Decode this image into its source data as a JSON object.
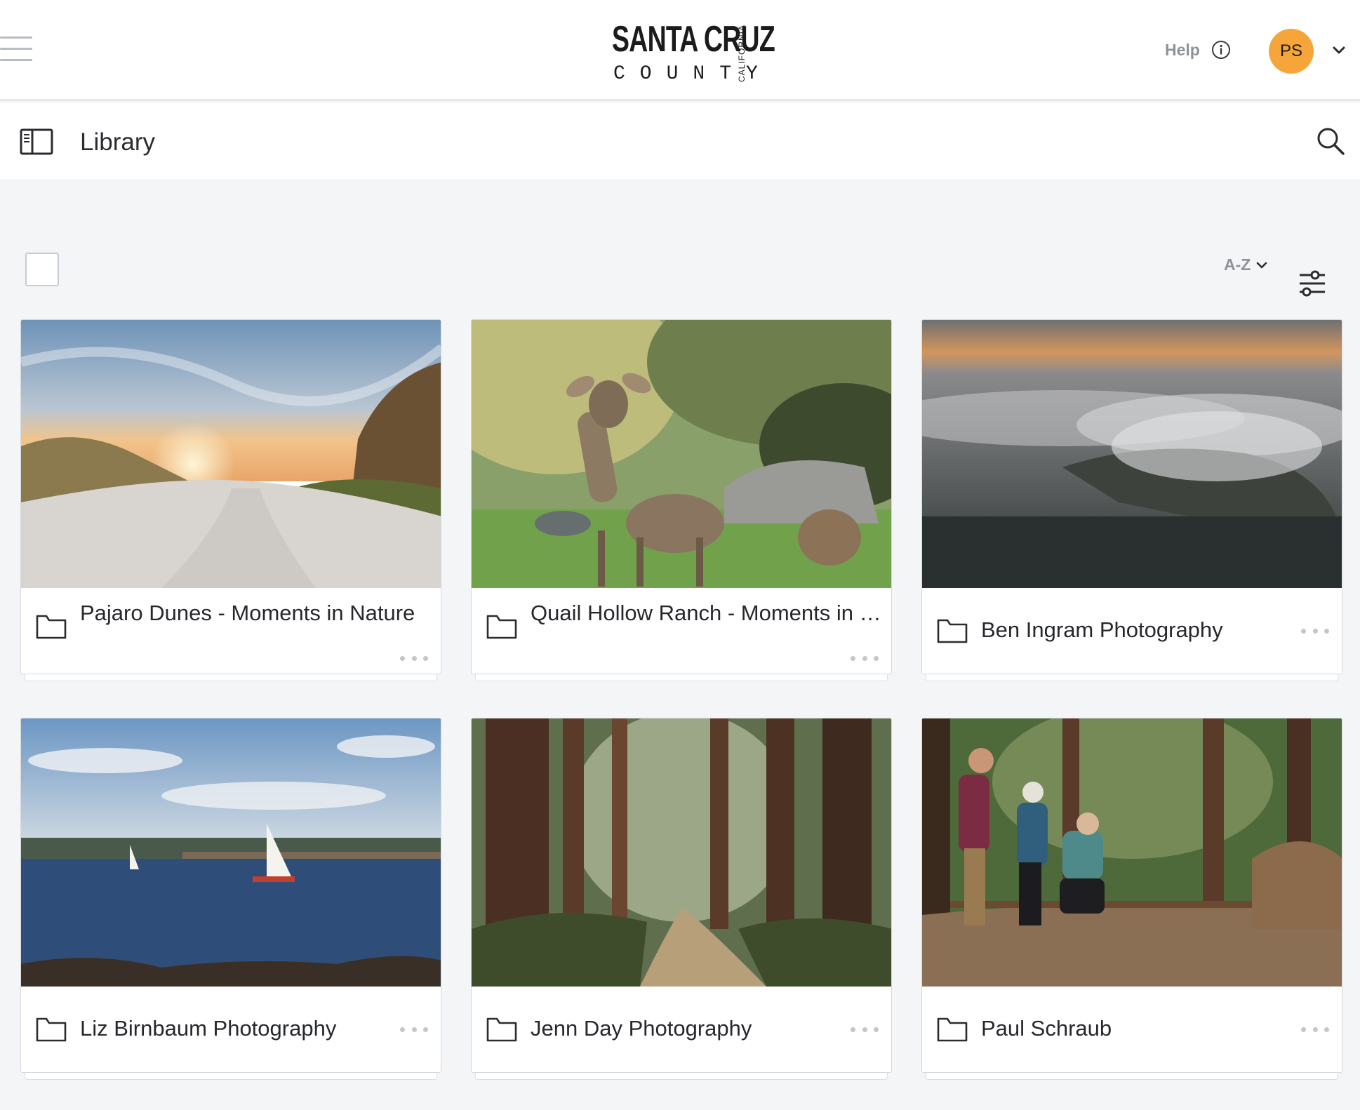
{
  "header": {
    "logo": {
      "line1": "SANTA CRUZ",
      "line2": "COUNTY",
      "state": "CALIFORNIA"
    },
    "help_label": "Help",
    "avatar_initials": "PS"
  },
  "library": {
    "title": "Library"
  },
  "controls": {
    "sort_label": "A-Z"
  },
  "cards": [
    {
      "title": "Pajaro Dunes - Moments in Nature",
      "scene": "dunes-sunset"
    },
    {
      "title": "Quail Hollow Ranch - Moments in Nature",
      "scene": "deer-meadow"
    },
    {
      "title": "Ben Ingram Photography",
      "scene": "fog-coastline"
    },
    {
      "title": "Liz Birnbaum Photography",
      "scene": "harbor-sailboat"
    },
    {
      "title": "Jenn Day Photography",
      "scene": "redwood-trail"
    },
    {
      "title": "Paul Schraub",
      "scene": "redwood-people"
    }
  ],
  "colors": {
    "avatar_bg": "#f5a53a",
    "muted_text": "#8d9199",
    "page_bg": "#f4f5f7"
  }
}
